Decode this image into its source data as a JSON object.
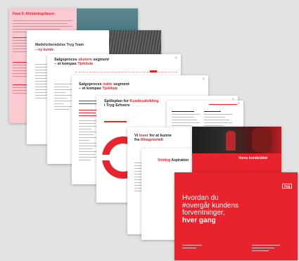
{
  "colors": {
    "brand_red": "#e8232d",
    "pink_panel": "#fbc9d1",
    "background": "#e3e3e3"
  },
  "page1": {
    "title": "Fase 5: Afslutningsfasen"
  },
  "page2": {
    "title_line1": "Mødeforberedelse Tryg Team",
    "title_line2": "– ny kunde"
  },
  "page3": {
    "title_line1_plain": "Salgsproces ",
    "title_line1_red": "ekstern",
    "title_line1_end": " segment",
    "title_line2_plain": "– et kompas ",
    "title_line2_red": "Tjekliste"
  },
  "page4": {
    "title_line1_plain": "Salgsproces ",
    "title_line1_red": "indre",
    "title_line1_end": " segment",
    "title_line2_plain": "– et kompas ",
    "title_line2_red": "Tjekliste"
  },
  "page5": {
    "title_line1_plain": "Spilleplan for ",
    "title_line1_red": "Kundeudvikling",
    "title_line2": "i Tryg Erhverv"
  },
  "page7": {
    "title_line1_plain": "Vi ",
    "title_line1_red": "lover",
    "title_line1_end": " for at kunne",
    "title_line2_plain": "fra ",
    "title_line2_red": "tilbagebetalt"
  },
  "page8": {
    "heading_red": "Vinding",
    "heading_rest": " Aspiration"
  },
  "page9": {
    "banner_text": "Vores kundeidéal"
  },
  "cover": {
    "logo": "tryg",
    "line1": "Hvordan du",
    "line2": "#overgår kundens",
    "line3": "forventninger,",
    "line4": "hver gang"
  }
}
